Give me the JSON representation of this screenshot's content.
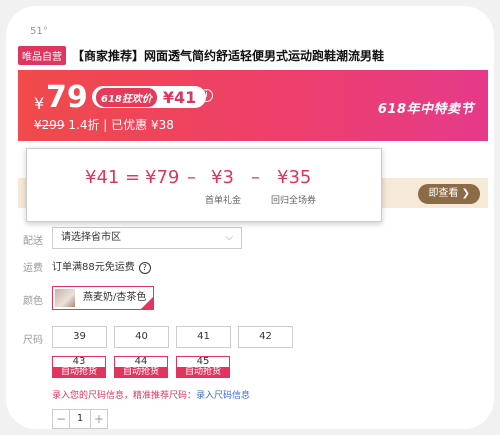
{
  "top_partial": "51°",
  "product": {
    "tag": "唯品自营",
    "title": "【商家推荐】网面透气简约舒适轻便男式运动跑鞋潮流男鞋"
  },
  "price": {
    "currency": "¥",
    "current": "79",
    "promo_label": "618狂欢价",
    "promo_price": "¥41",
    "info_icon": "ⓘ",
    "original": "¥299",
    "discount": "1.4折",
    "saved": "| 已优惠 ¥38",
    "festival": "618年中特卖节"
  },
  "coupon_popup": {
    "result": "¥41",
    "eq": "=",
    "base": "¥79",
    "minus1": "–",
    "d1_value": "¥3",
    "d1_label": "首单礼金",
    "minus2": "–",
    "d2_value": "¥35",
    "d2_label": "回归全场券"
  },
  "view_button": "即查看 ❯",
  "delivery": {
    "label": "配送",
    "placeholder": "请选择省市区"
  },
  "shipping": {
    "label": "运费",
    "text": "订单满88元免运费",
    "help_icon": "?"
  },
  "color": {
    "label": "颜色",
    "selected": "燕麦奶/杏茶色"
  },
  "size": {
    "label": "尺码",
    "available": [
      "39",
      "40",
      "41",
      "42"
    ],
    "out_of_stock": [
      "43",
      "44",
      "45"
    ],
    "oos_tag": "自动抢货"
  },
  "size_tip": {
    "text": "录入您的尺码信息，精准推荐尺码：",
    "link": "录入尺码信息"
  },
  "quantity": {
    "minus": "−",
    "value": "1",
    "plus": "+"
  }
}
